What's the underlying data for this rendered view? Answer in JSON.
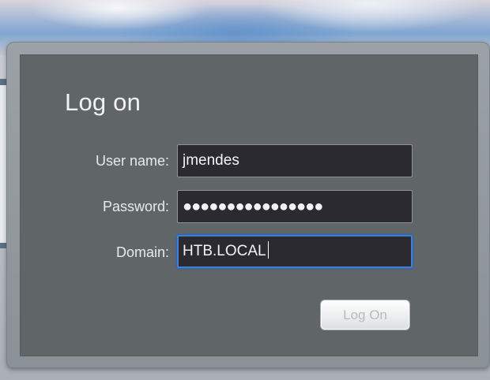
{
  "login": {
    "title": "Log on",
    "username_label": "User name:",
    "username_value": "jmendes",
    "password_label": "Password:",
    "password_value": "●●●●●●●●●●●●●●●●",
    "domain_label": "Domain:",
    "domain_value": "HTB.LOCAL",
    "submit_label": "Log On"
  },
  "colors": {
    "panel": "#606668",
    "field_bg": "#2b2a31",
    "focus_border": "#3f7fd6"
  }
}
